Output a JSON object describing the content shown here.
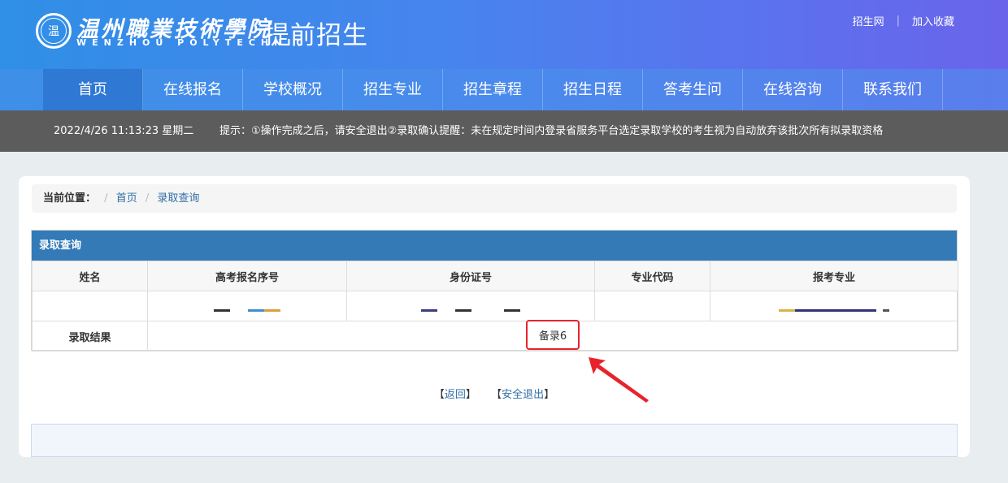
{
  "header": {
    "emblem_text": "温",
    "school_name_cn": "温州職業技術學院",
    "school_name_en": "WENZHOU POLYTECHNIC",
    "site_title": "提前招生",
    "top_links": [
      "招生网",
      "加入收藏"
    ],
    "separator": "|"
  },
  "nav": {
    "items": [
      "首页",
      "在线报名",
      "学校概况",
      "招生专业",
      "招生章程",
      "招生日程",
      "答考生问",
      "在线咨询",
      "联系我们"
    ],
    "active_index": 0
  },
  "notice": {
    "datetime": "2022/4/26 11:13:23 星期二",
    "tip": "提示：①操作完成之后，请安全退出②录取确认提醒：未在规定时间内登录省服务平台选定录取学校的考生视为自动放弃该批次所有拟录取资格"
  },
  "breadcrumb": {
    "label": "当前位置：",
    "separator": "/",
    "items": [
      "首页",
      "录取查询"
    ]
  },
  "panel": {
    "title": "录取查询",
    "headers": [
      "姓名",
      "高考报名序号",
      "身份证号",
      "专业代码",
      "报考专业"
    ],
    "result_label": "录取结果",
    "result_value": "备录6"
  },
  "actions": {
    "back": "返回",
    "logout": "安全退出",
    "bracket_open": "【",
    "bracket_close": "】"
  },
  "colors": {
    "header_start": "#2f8fe6",
    "header_end": "#6a64ea",
    "panel_head": "#337ab7",
    "highlight": "#e8232b",
    "notice_bar": "#5c5c5c"
  }
}
